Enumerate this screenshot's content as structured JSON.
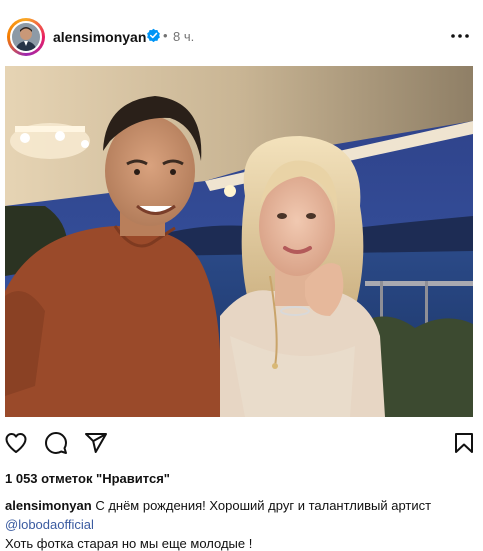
{
  "post": {
    "username": "alensimonyan",
    "dot": "•",
    "time": "8 ч.",
    "likes": "1 053 отметок \"Нравится\"",
    "caption": {
      "username": "alensimonyan",
      "line1": " С днём рождения! Хороший друг и талантливый артист",
      "mention": "@lobodaofficial",
      "line3": "Хоть фотка старая но мы еще молодые !"
    }
  },
  "icons": {
    "verified": "verified-badge-icon",
    "more": "more-options-icon",
    "like": "heart-icon",
    "comment": "comment-icon",
    "share": "share-icon",
    "save": "bookmark-icon"
  },
  "colors": {
    "verified": "#0095f6",
    "mention": "#3a5ba0",
    "time": "#737373"
  }
}
